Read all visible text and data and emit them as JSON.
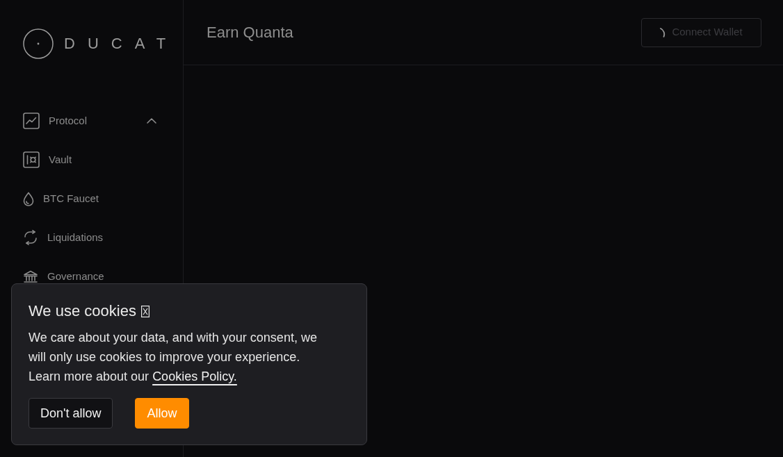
{
  "sidebar": {
    "logo": "DUCAT",
    "items": [
      {
        "label": "Protocol",
        "expanded": true
      },
      {
        "label": "Vault"
      },
      {
        "label": "BTC Faucet"
      },
      {
        "label": "Liquidations"
      },
      {
        "label": "Governance"
      }
    ]
  },
  "header": {
    "title": "Earn Quanta",
    "connect_button": {
      "label": "Connect Wallet",
      "disabled": true,
      "loading": true
    }
  },
  "cookie_banner": {
    "title": "We use cookies",
    "message": "We care about your data, and with your consent, we will only use cookies to improve your experience. Learn more about our",
    "link": "Cookies Policy.",
    "buttons": [
      {
        "label": "Don't allow",
        "kind": "secondary"
      },
      {
        "label": "Allow",
        "kind": "primary"
      }
    ]
  }
}
